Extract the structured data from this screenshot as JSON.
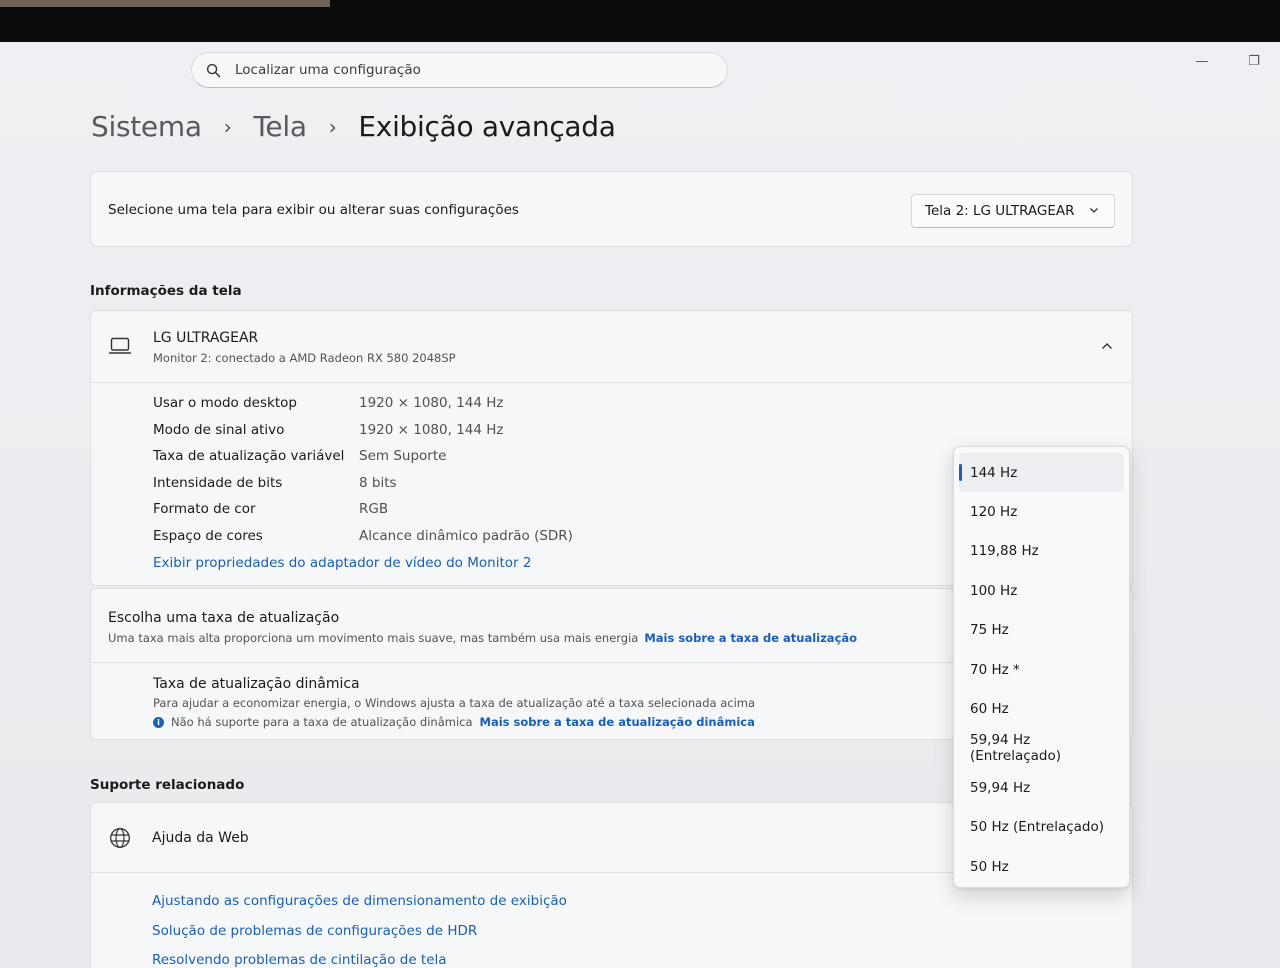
{
  "search": {
    "placeholder": "Localizar uma configuração"
  },
  "window_controls": {
    "minimize": "—",
    "restore": "❐"
  },
  "breadcrumb": [
    "Sistema",
    "Tela",
    "Exibição avançada"
  ],
  "display_select": {
    "label": "Selecione uma tela para exibir ou alterar suas configurações",
    "value": "Tela 2: LG ULTRAGEAR"
  },
  "display_info": {
    "section_title": "Informações da tela",
    "name": "LG ULTRAGEAR",
    "subtitle": "Monitor 2: conectado a AMD Radeon RX 580 2048SP",
    "rows": [
      {
        "key": "Usar o modo desktop",
        "value": "1920 × 1080, 144 Hz"
      },
      {
        "key": "Modo de sinal ativo",
        "value": "1920 × 1080, 144 Hz"
      },
      {
        "key": "Taxa de atualização variável",
        "value": "Sem Suporte"
      },
      {
        "key": "Intensidade de bits",
        "value": "8 bits"
      },
      {
        "key": "Formato de cor",
        "value": "RGB"
      },
      {
        "key": "Espaço de cores",
        "value": "Alcance dinâmico padrão (SDR)"
      }
    ],
    "adapter_link": "Exibir propriedades do adaptador de vídeo do Monitor 2"
  },
  "refresh": {
    "title": "Escolha uma taxa de atualização",
    "description": "Uma taxa mais alta proporciona um movimento mais suave, mas também usa mais energia",
    "link": "Mais sobre a taxa de atualização",
    "dynamic": {
      "title": "Taxa de atualização dinâmica",
      "description": "Para ajudar a economizar energia, o Windows ajusta a taxa de atualização até a taxa selecionada acima",
      "notice": "Não há suporte para a taxa de atualização dinâmica",
      "link": "Mais sobre a taxa de atualização dinâmica"
    },
    "options": [
      "144 Hz",
      "120 Hz",
      "119,88 Hz",
      "100 Hz",
      "75 Hz",
      "70 Hz *",
      "60 Hz",
      "59,94 Hz (Entrelaçado)",
      "59,94 Hz",
      "50 Hz (Entrelaçado)",
      "50 Hz"
    ],
    "selected": "144 Hz"
  },
  "support": {
    "section_title": "Suporte relacionado",
    "web_help": "Ajuda da Web",
    "links": [
      "Ajustando as configurações de dimensionamento de exibição",
      "Solução de problemas de configurações de HDR",
      "Resolvendo problemas de cintilação de tela"
    ]
  },
  "colors": {
    "accent": "#1a5fb4",
    "background": "#e9ebee",
    "card": "#f6f7f9"
  }
}
